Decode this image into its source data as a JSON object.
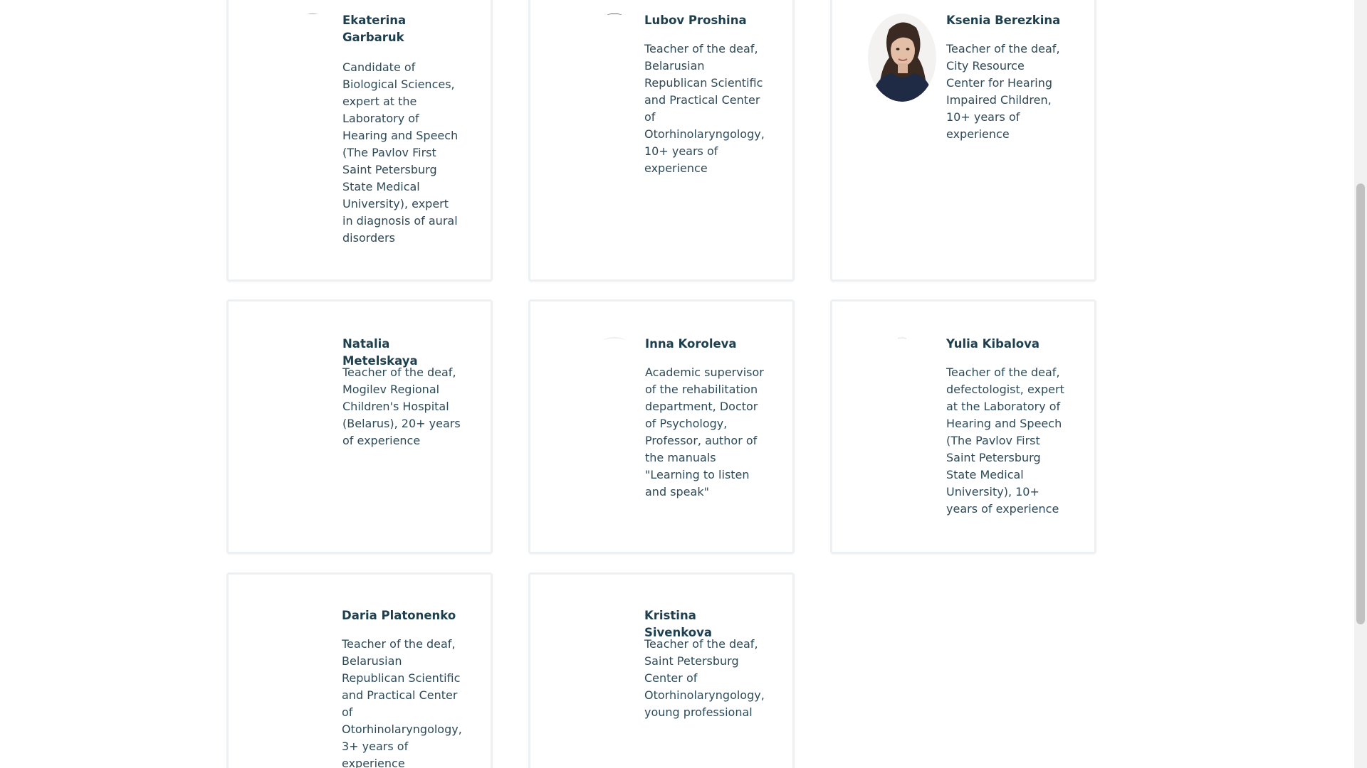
{
  "team": [
    {
      "name": "Ekaterina Garbaruk",
      "description": "Candidate of Biological Sciences, expert at the Laboratory of Hearing and Speech (The Pavlov First Saint Petersburg State Medical University), expert in diagnosis of aural disorders"
    },
    {
      "name": "Lubov Proshina",
      "description": "Teacher of the deaf, Belarusian Republican Scientific and Practical Center of Otorhinolaryngology, 10+ years of experience"
    },
    {
      "name": "Ksenia Berezkina",
      "description": "Teacher of the deaf, City Resource Center for Hearing Impaired Children, 10+ years of experience"
    },
    {
      "name": "Natalia Metelskaya",
      "description": "Teacher of the deaf, Mogilev Regional Children's Hospital (Belarus), 20+ years of experience"
    },
    {
      "name": "Inna Koroleva",
      "description": "Academic supervisor of the rehabilitation department, Doctor of Psychology, Professor, author of the manuals \"Learning to listen and speak\""
    },
    {
      "name": "Yulia Kibalova",
      "description": "Teacher of the deaf, defectologist, expert at the Laboratory of Hearing and Speech (The Pavlov First Saint Petersburg State Medical University), 10+ years of experience"
    },
    {
      "name": "Daria Platonenko",
      "description": "Teacher of the deaf, Belarusian Republican Scientific and Practical Center of Otorhinolaryngology, 3+ years of experience"
    },
    {
      "name": "Kristina Sivenkova",
      "description": "Teacher of the deaf, Saint Petersburg Center of Otorhinolaryngology, young professional"
    }
  ],
  "colors": {
    "name_text": "#1e3f4e",
    "description_text": "#2e4a58",
    "card_border": "#eef1f4",
    "scrollbar_thumb": "#c1c1c1"
  }
}
